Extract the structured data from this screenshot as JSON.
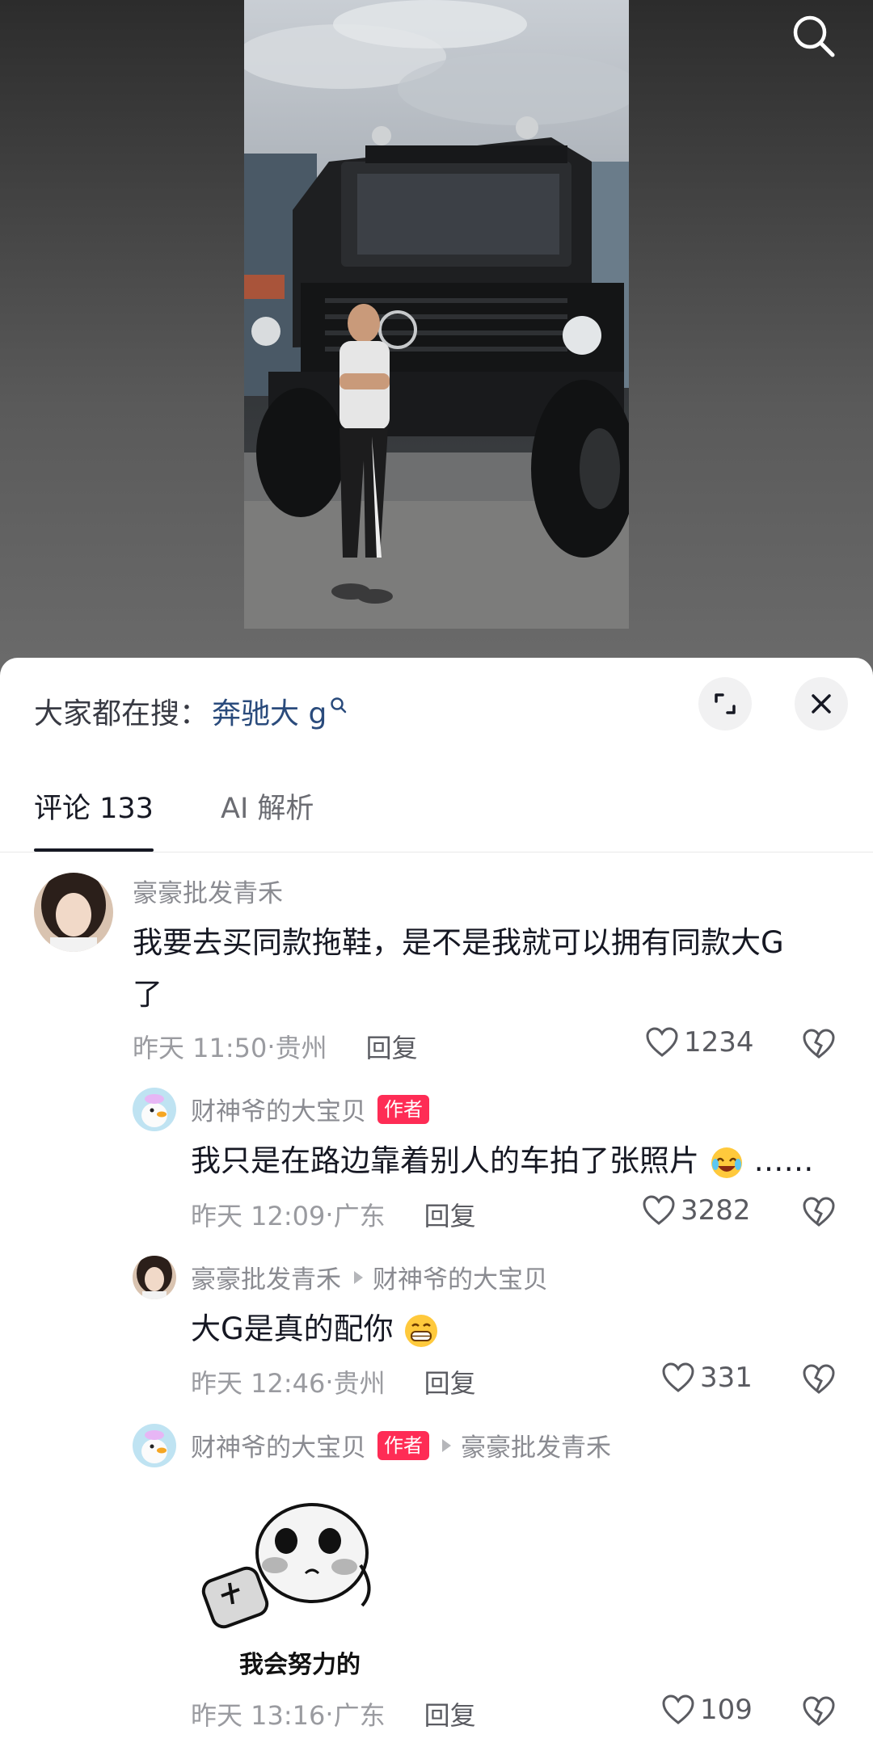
{
  "search_hint": {
    "prefix": "大家都在搜：",
    "keyword": "奔驰大 g"
  },
  "tabs": [
    {
      "label": "评论 133",
      "active": true
    },
    {
      "label": "AI 解析",
      "active": false
    }
  ],
  "comments": [
    {
      "user": "豪豪批发青禾",
      "text_line1": "我要去买同款拖鞋，是不是我就可以拥有同款大G",
      "text_line2": "了",
      "time": "昨天 11:50",
      "location": "贵州",
      "reply_label": "回复",
      "likes": "1234"
    },
    {
      "user": "财神爷的大宝贝",
      "badge": "作者",
      "text": "我只是在路边靠着别人的车拍了张照片",
      "text_suffix": "……",
      "time": "昨天 12:09",
      "location": "广东",
      "reply_label": "回复",
      "likes": "3282"
    },
    {
      "user": "豪豪批发青禾",
      "reply_to": "财神爷的大宝贝",
      "text": "大G是真的配你",
      "time": "昨天 12:46",
      "location": "贵州",
      "reply_label": "回复",
      "likes": "331"
    },
    {
      "user": "财神爷的大宝贝",
      "badge": "作者",
      "reply_to": "豪豪批发青禾",
      "sticker_caption": "我会努力的",
      "time": "昨天 13:16",
      "location": "广东",
      "reply_label": "回复",
      "likes": "109"
    }
  ],
  "separator": "·",
  "colors": {
    "accent": "#fe2c55",
    "keyword": "#2a4b7c",
    "text": "#161823",
    "muted": "#9a9ba0"
  }
}
